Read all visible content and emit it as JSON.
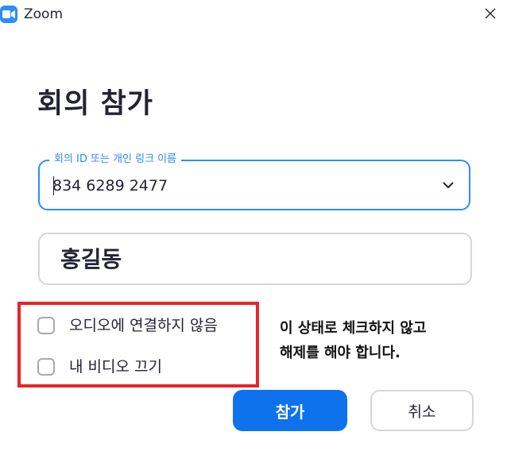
{
  "window": {
    "title": "Zoom"
  },
  "dialog": {
    "heading": "회의 참가",
    "meeting_id": {
      "legend": "회의 ID 또는 개인 링크 이름",
      "value": "834 6289 2477"
    },
    "name": {
      "value": "홍길동"
    },
    "options": [
      {
        "label": "오디오에 연결하지 않음",
        "checked": false
      },
      {
        "label": "내 비디오 끄기",
        "checked": false
      }
    ],
    "annotation": "이 상태로 체크하지 않고\n해제를 해야 합니다.",
    "join_label": "참가",
    "cancel_label": "취소"
  },
  "colors": {
    "accent": "#2d8cff",
    "primary_button": "#0e72ed",
    "highlight": "#e8232a",
    "border": "#d6d6dc"
  },
  "icons": {
    "app": "zoom-camera-icon",
    "close": "close-icon",
    "dropdown": "chevron-down-icon"
  }
}
